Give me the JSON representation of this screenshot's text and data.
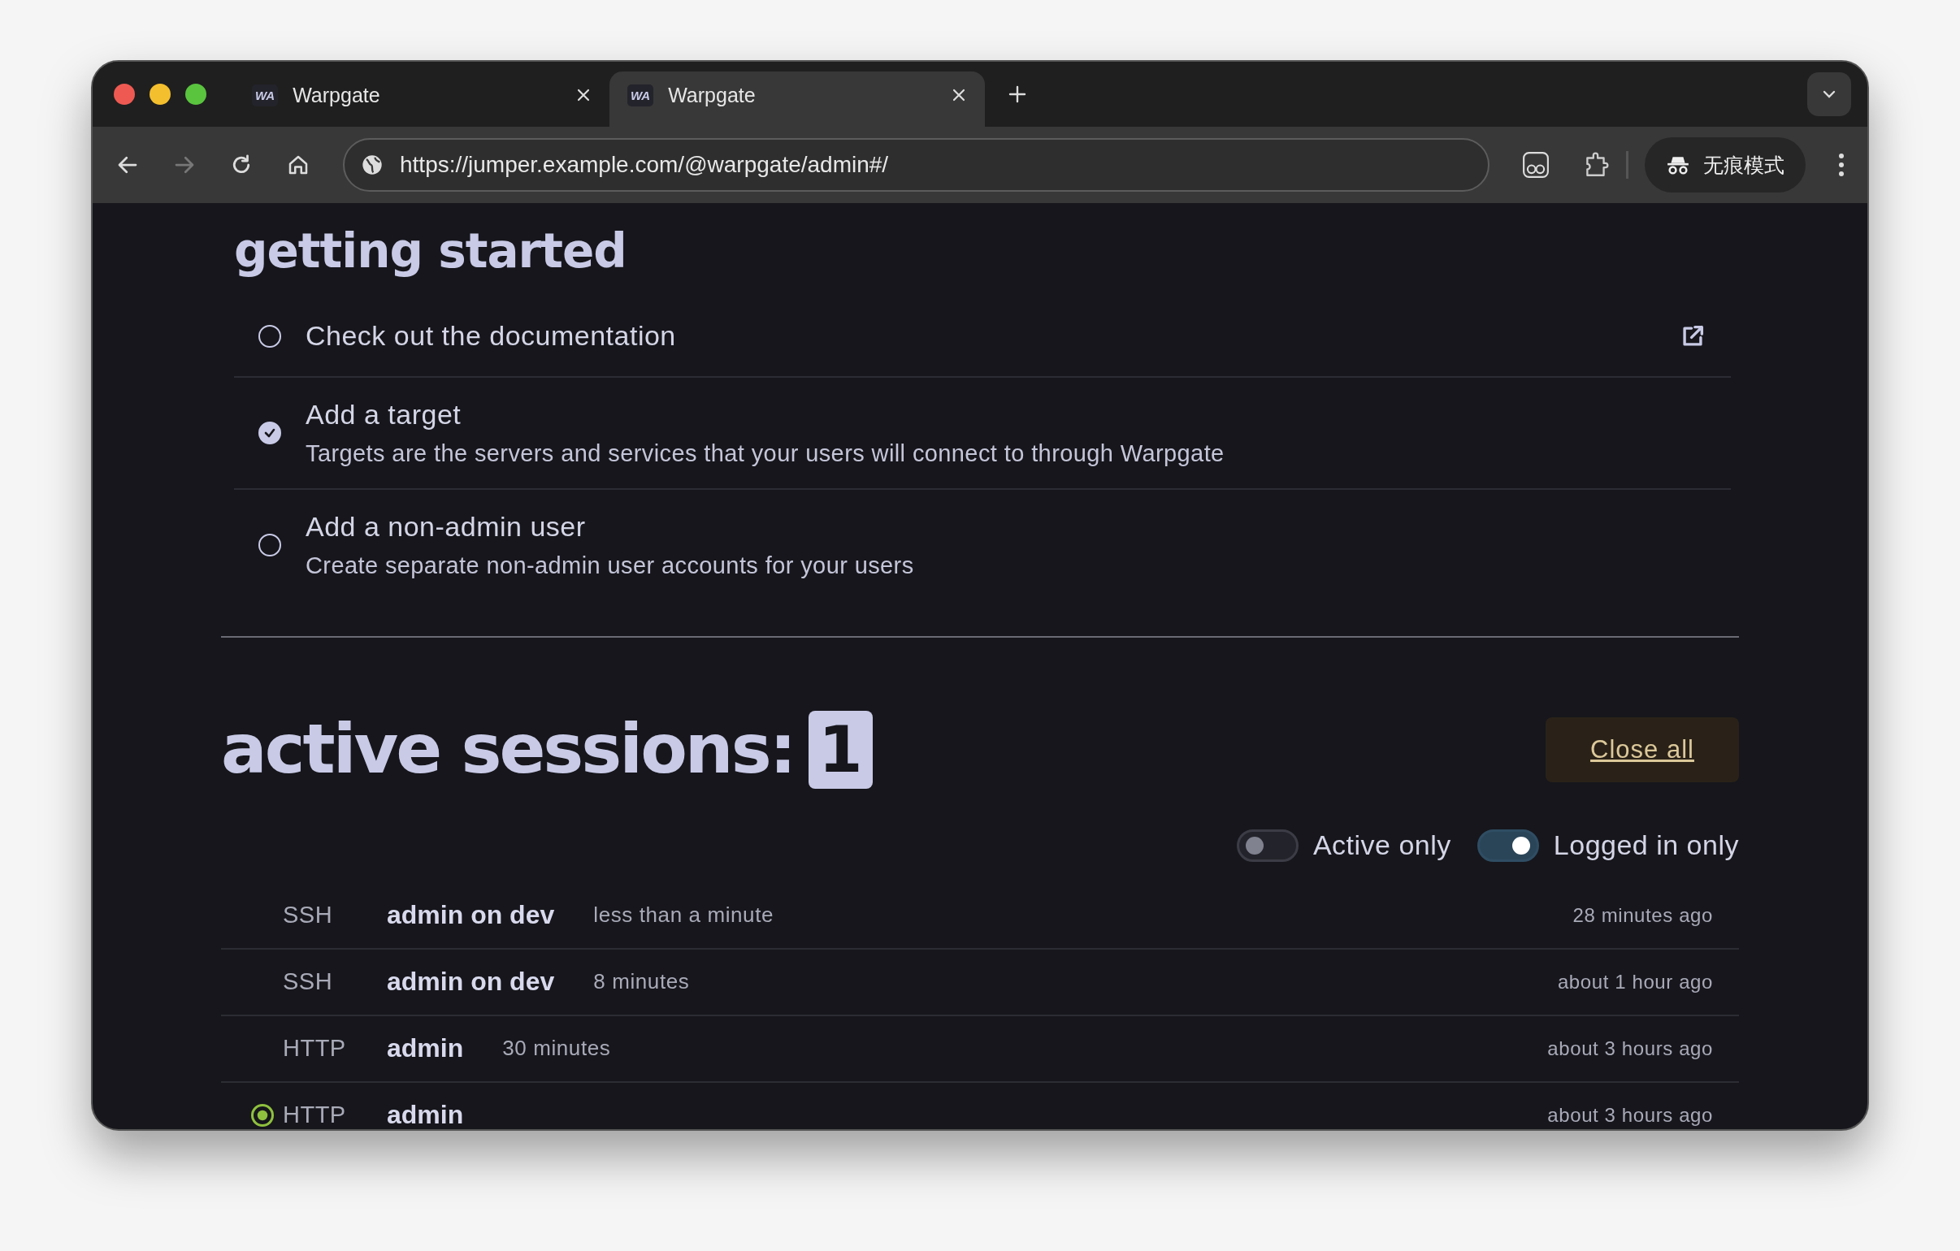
{
  "browser": {
    "tabs": [
      {
        "favicon": "WA",
        "title": "Warpgate",
        "selected": false
      },
      {
        "favicon": "WA",
        "title": "Warpgate",
        "selected": true
      }
    ],
    "url": "https://jumper.example.com/@warpgate/admin#/",
    "forward_disabled": true,
    "incognito_label": "无痕模式"
  },
  "getting_started": {
    "title": "getting started",
    "items": [
      {
        "title": "Check out the documentation",
        "checked": false,
        "external_link": true
      },
      {
        "title": "Add a target",
        "description": "Targets are the servers and services that your users will connect to through Warpgate",
        "checked": true,
        "external_link": false
      },
      {
        "title": "Add a non-admin user",
        "description": "Create separate non-admin user accounts for your users",
        "checked": false,
        "external_link": false
      }
    ]
  },
  "active_sessions": {
    "title": "active sessions:",
    "count": "1",
    "close_all": "Close all",
    "filters": [
      {
        "label": "Active only",
        "on": false
      },
      {
        "label": "Logged in only",
        "on": true
      }
    ],
    "sessions": [
      {
        "protocol": "SSH",
        "name": "admin on dev",
        "duration": "less than a minute",
        "started": "28 minutes ago",
        "active": false
      },
      {
        "protocol": "SSH",
        "name": "admin on dev",
        "duration": "8 minutes",
        "started": "about 1 hour ago",
        "active": false
      },
      {
        "protocol": "HTTP",
        "name": "admin",
        "duration": "30 minutes",
        "started": "about 3 hours ago",
        "active": false
      },
      {
        "protocol": "HTTP",
        "name": "admin",
        "started": "about 3 hours ago",
        "active": true
      }
    ]
  }
}
